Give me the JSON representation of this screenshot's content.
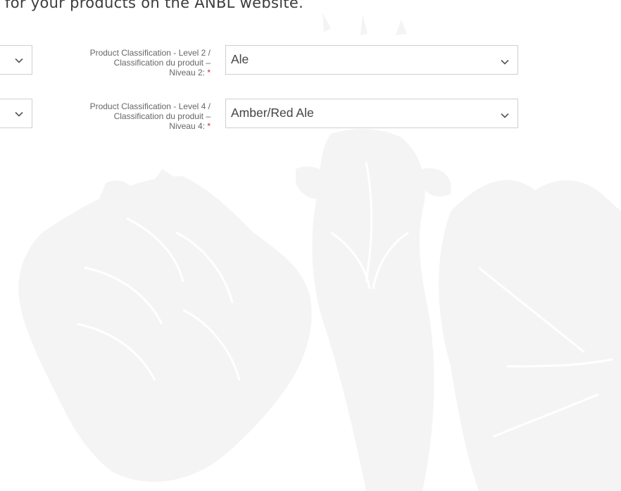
{
  "intro_text": "for your products on the ANBL website.",
  "fields": [
    {
      "label_line1": "Product Classification - Level 2 /",
      "label_line2": "Classification du produit –",
      "label_line3": "Niveau 2:",
      "required_mark": "*",
      "selected_value": "Ale"
    },
    {
      "label_line1": "Product Classification - Level 4 /",
      "label_line2": "Classification du produit –",
      "label_line3": "Niveau 4:",
      "required_mark": "*",
      "selected_value": "Amber/Red Ale"
    }
  ],
  "icons": {
    "dropdown": "chevron-down-icon",
    "background": "hops-wheat-grapes-watermark"
  },
  "colors": {
    "required": "#d9232e",
    "label": "#666666",
    "border": "#cfcfcf",
    "watermark": "#f3f3f3"
  }
}
